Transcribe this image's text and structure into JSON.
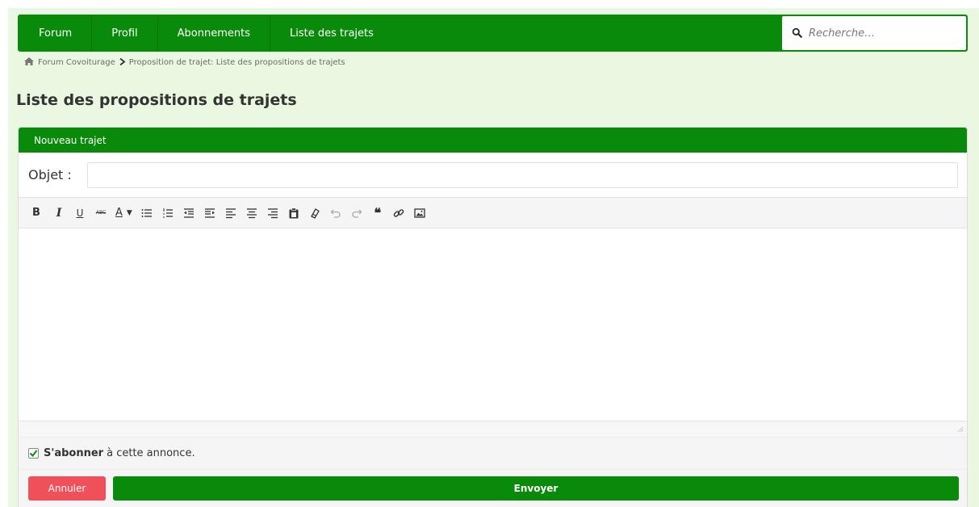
{
  "nav": {
    "items": [
      {
        "label": "Forum"
      },
      {
        "label": "Profil"
      },
      {
        "label": "Abonnements"
      },
      {
        "label": "Liste des trajets"
      }
    ],
    "search": {
      "placeholder": "Recherche…",
      "icon": "search-icon"
    }
  },
  "breadcrumb": {
    "home_icon": "home-icon",
    "root": "Forum Covoiturage",
    "current": "Proposition de trajet: Liste des propositions de trajets"
  },
  "page_title": "Liste des propositions de trajets",
  "form": {
    "header": "Nouveau trajet",
    "subject_label": "Objet :",
    "subject_value": "",
    "toolbar": {
      "bold": "B",
      "italic": "I",
      "underline": "U",
      "strike": "ABC",
      "font_color": "A"
    },
    "subscribe": {
      "checked": true,
      "bold_label": "S'abonner",
      "rest_label": "à cette annonce."
    },
    "cancel_label": "Annuler",
    "send_label": "Envoyer"
  },
  "colors": {
    "brand_green": "#0a8a0a",
    "background": "#eaf8e2",
    "cancel_red": "#f0505a"
  }
}
